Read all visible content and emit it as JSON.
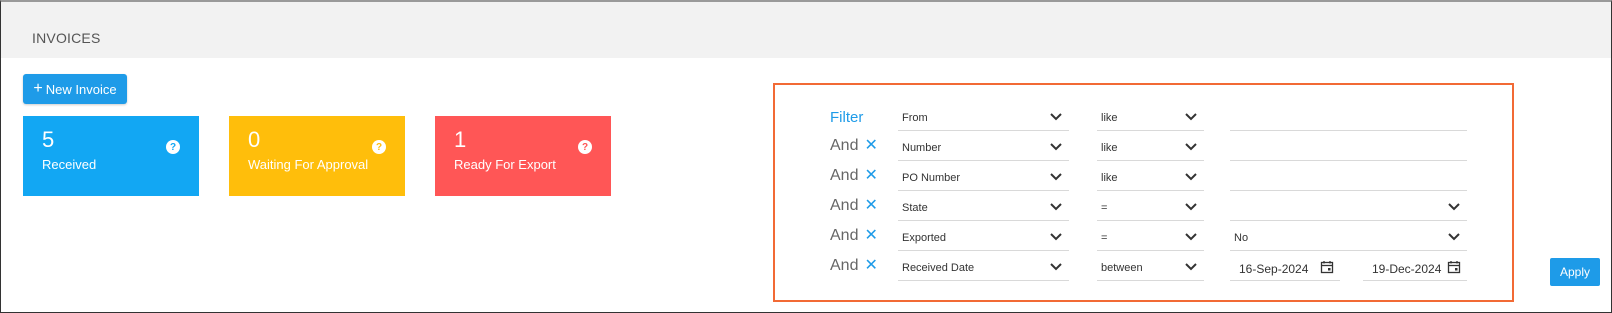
{
  "page": {
    "title": "INVOICES"
  },
  "toolbar": {
    "new_invoice_plus": "+",
    "new_invoice_label": "New Invoice"
  },
  "cards": [
    {
      "count": "5",
      "label": "Received",
      "help": "?"
    },
    {
      "count": "0",
      "label": "Waiting For Approval",
      "help": "?"
    },
    {
      "count": "1",
      "label": "Ready For Export",
      "help": "?"
    }
  ],
  "filter": {
    "title": "Filter",
    "conjunction": "And",
    "remove_glyph": "✕",
    "rows": [
      {
        "field": "From",
        "operator": "like",
        "value": ""
      },
      {
        "field": "Number",
        "operator": "like",
        "value": ""
      },
      {
        "field": "PO Number",
        "operator": "like",
        "value": ""
      },
      {
        "field": "State",
        "operator": "=",
        "value": ""
      },
      {
        "field": "Exported",
        "operator": "=",
        "value": "No"
      },
      {
        "field": "Received Date",
        "operator": "between",
        "value_from": "16-Sep-2024",
        "value_to": "19-Dec-2024"
      }
    ],
    "apply_label": "Apply"
  },
  "colors": {
    "accent": "#1e9be8",
    "card_received": "#12a7f3",
    "card_waiting": "#ffbe0b",
    "card_export": "#ff5656",
    "filter_highlight": "#f26a35"
  },
  "icons": {
    "dropdown": "chevron-down-icon",
    "calendar": "calendar-icon",
    "help": "help-circle-icon",
    "remove": "close-icon"
  }
}
